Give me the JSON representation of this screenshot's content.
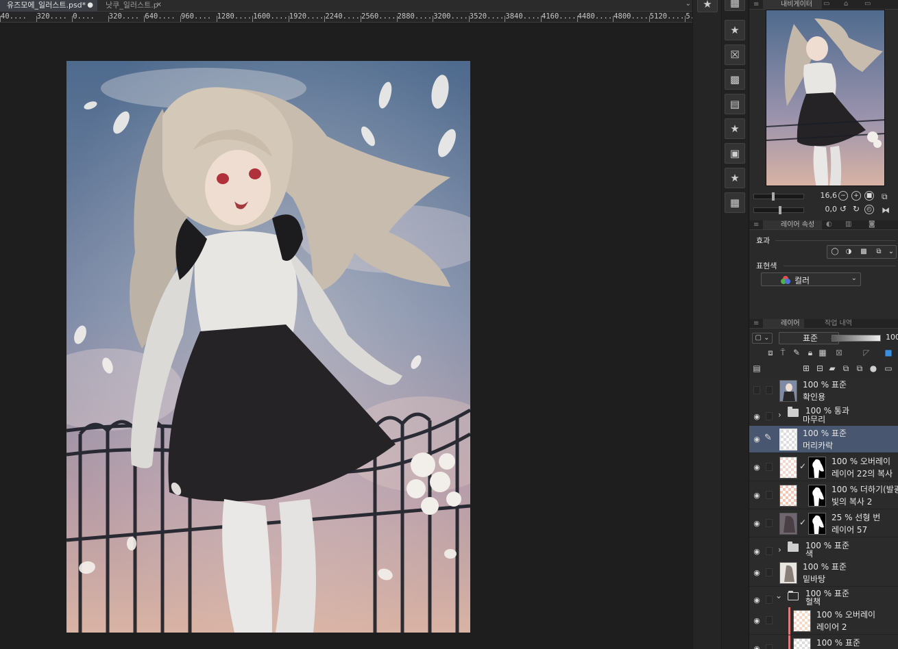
{
  "tabs": [
    {
      "label": "유즈모에_일러스트.psd*",
      "active": true,
      "marker": "●"
    },
    {
      "label": "낫쿠_일러스트.p",
      "active": false,
      "marker": "✕"
    }
  ],
  "tab_more_icon": "chevron-down-icon",
  "ruler": {
    "labels": [
      "40",
      "320",
      "0",
      "320",
      "640",
      "960",
      "1280",
      "1600",
      "1920",
      "2240",
      "2560",
      "2880",
      "3200",
      "3520",
      "3840",
      "4160",
      "4480",
      "4800",
      "5120",
      "5"
    ]
  },
  "side_icons": [
    "favorite-icon",
    "palette-grid-icon",
    "favorite-icon",
    "close-box-icon",
    "pattern-icon",
    "text-icon",
    "favorite-icon",
    "image-icon",
    "favorite-icon",
    "grid-icon"
  ],
  "navigator": {
    "tab_label": "내비게이터",
    "zoom_value": "16,6",
    "rotate_value": "0,0"
  },
  "layer_property": {
    "tab_label": "레이어 속성",
    "effect_label": "효과",
    "expression_label": "표현색",
    "expression_value": "컬러"
  },
  "layer_panel": {
    "tab_label": "레이어",
    "history_tab_label": "작업 내역",
    "blend_mode": "표준",
    "opacity": "100"
  },
  "layers": [
    {
      "mode": "100 % 표준",
      "name": "확인용",
      "visible": false,
      "kind": "image"
    },
    {
      "mode": "100 % 통과",
      "name": "마무리",
      "visible": true,
      "kind": "folder"
    },
    {
      "mode": "100 % 표준",
      "name": "머리카락",
      "visible": true,
      "kind": "layer",
      "selected": true
    },
    {
      "mode": "100 % 오버레이",
      "name": "레이어 22의 복사",
      "visible": true,
      "kind": "masked"
    },
    {
      "mode": "100 % 더하기(발광)",
      "name": "빛의 복사 2",
      "visible": true,
      "kind": "masked"
    },
    {
      "mode": "25 % 선형 번",
      "name": "레이어 57",
      "visible": true,
      "kind": "masked"
    },
    {
      "mode": "100 % 표준",
      "name": "색",
      "visible": true,
      "kind": "folder"
    },
    {
      "mode": "100 % 표준",
      "name": "밑바탕",
      "visible": true,
      "kind": "image"
    },
    {
      "mode": "100 % 표준",
      "name": "혈책",
      "visible": true,
      "kind": "folder-open"
    },
    {
      "mode": "100 % 오버레이",
      "name": "레이어 2",
      "visible": true,
      "kind": "clipped"
    },
    {
      "mode": "100 % 표준",
      "name": "",
      "visible": true,
      "kind": "clipped"
    }
  ],
  "colors": {
    "selected_layer": "#495670",
    "panel_bg": "#2a2a2a",
    "canvas_bg": "#1e1e1e",
    "clip_bar": "#e07b7b"
  }
}
